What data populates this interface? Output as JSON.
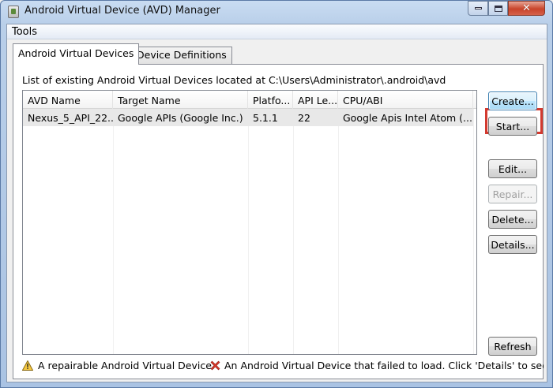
{
  "window": {
    "title": "Android Virtual Device (AVD) Manager"
  },
  "menu": {
    "tools": "Tools"
  },
  "tabs": [
    {
      "label": "Android Virtual Devices",
      "active": true
    },
    {
      "label": "Device Definitions",
      "active": false
    }
  ],
  "path_label": "List of existing Android Virtual Devices located at C:\\Users\\Administrator\\.android\\avd",
  "table": {
    "columns": [
      "AVD Name",
      "Target Name",
      "Platfo...",
      "API Le...",
      "CPU/ABI"
    ],
    "rows": [
      [
        "Nexus_5_API_22...",
        "Google APIs (Google Inc.)",
        "5.1.1",
        "22",
        "Google Apis Intel Atom (..."
      ]
    ]
  },
  "buttons": {
    "create": "Create...",
    "start": "Start...",
    "edit": "Edit...",
    "repair": "Repair...",
    "delete": "Delete...",
    "details": "Details...",
    "refresh": "Refresh"
  },
  "legend": {
    "repairable": "A repairable Android Virtual Device.",
    "failed": "An Android Virtual Device that failed to load. Click 'Details' to see the error."
  },
  "colors": {
    "highlight": "#d33a2f",
    "selected_row": "#e8e8e8"
  }
}
